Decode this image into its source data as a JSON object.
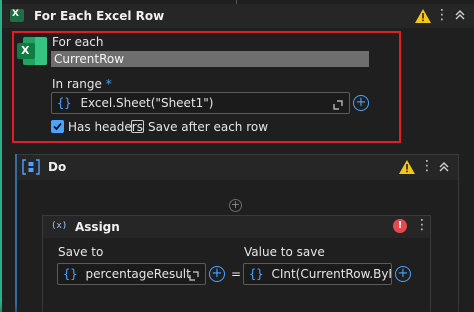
{
  "outer": {
    "title": "For Each Excel Row",
    "for_each_label": "For each",
    "for_each_value": "CurrentRow",
    "in_range_label": "In range",
    "required_mark": "*",
    "range_value": "Excel.Sheet(\"Sheet1\")",
    "has_headers_label": "Has headers",
    "has_headers_checked": true,
    "save_after_label": "Save after each row",
    "save_after_checked": false,
    "excel_icon_letter": "X",
    "highlight_color": "#e11d2a"
  },
  "do": {
    "title": "Do"
  },
  "assign": {
    "title": "Assign",
    "save_to_label": "Save to",
    "save_to_value": "percentageResult",
    "equals": "=",
    "value_label": "Value to save",
    "value_value": "CInt(CurrentRow.ByFie",
    "error_symbol": "!"
  },
  "icons": {
    "brace": "{}",
    "assign_icon": "(x)",
    "do_icon": "[{}]",
    "more": "⋮"
  },
  "colors": {
    "accent": "#4aa3ff",
    "warning": "#f5c518",
    "error": "#e5484d",
    "excel_green": "#1d7044"
  }
}
